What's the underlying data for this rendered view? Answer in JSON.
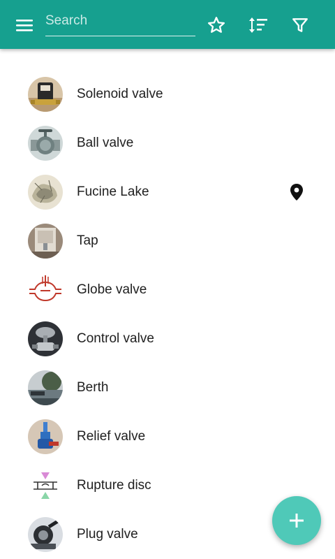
{
  "appbar": {
    "search_placeholder": "Search",
    "menu_icon": "hamburger-menu-icon",
    "favorite_icon": "star-outline-icon",
    "sort_icon": "sort-icon",
    "filter_icon": "filter-icon",
    "color": "#16a08f"
  },
  "items": [
    {
      "label": "Solenoid valve",
      "image": "solenoid-valve-photo"
    },
    {
      "label": "Ball valve",
      "image": "ball-valve-photo"
    },
    {
      "label": "Fucine Lake",
      "image": "fucine-lake-photo",
      "location_icon": "map-pin-icon"
    },
    {
      "label": "Tap",
      "image": "tap-photo"
    },
    {
      "label": "Globe valve",
      "image": "globe-valve-diagram"
    },
    {
      "label": "Control valve",
      "image": "control-valve-photo"
    },
    {
      "label": "Berth",
      "image": "berth-photo"
    },
    {
      "label": "Relief valve",
      "image": "relief-valve-photo"
    },
    {
      "label": "Rupture disc",
      "image": "rupture-disc-diagram"
    },
    {
      "label": "Plug valve",
      "image": "plug-valve-photo"
    }
  ],
  "fab": {
    "icon": "plus-icon",
    "color": "#4fc9b8"
  }
}
